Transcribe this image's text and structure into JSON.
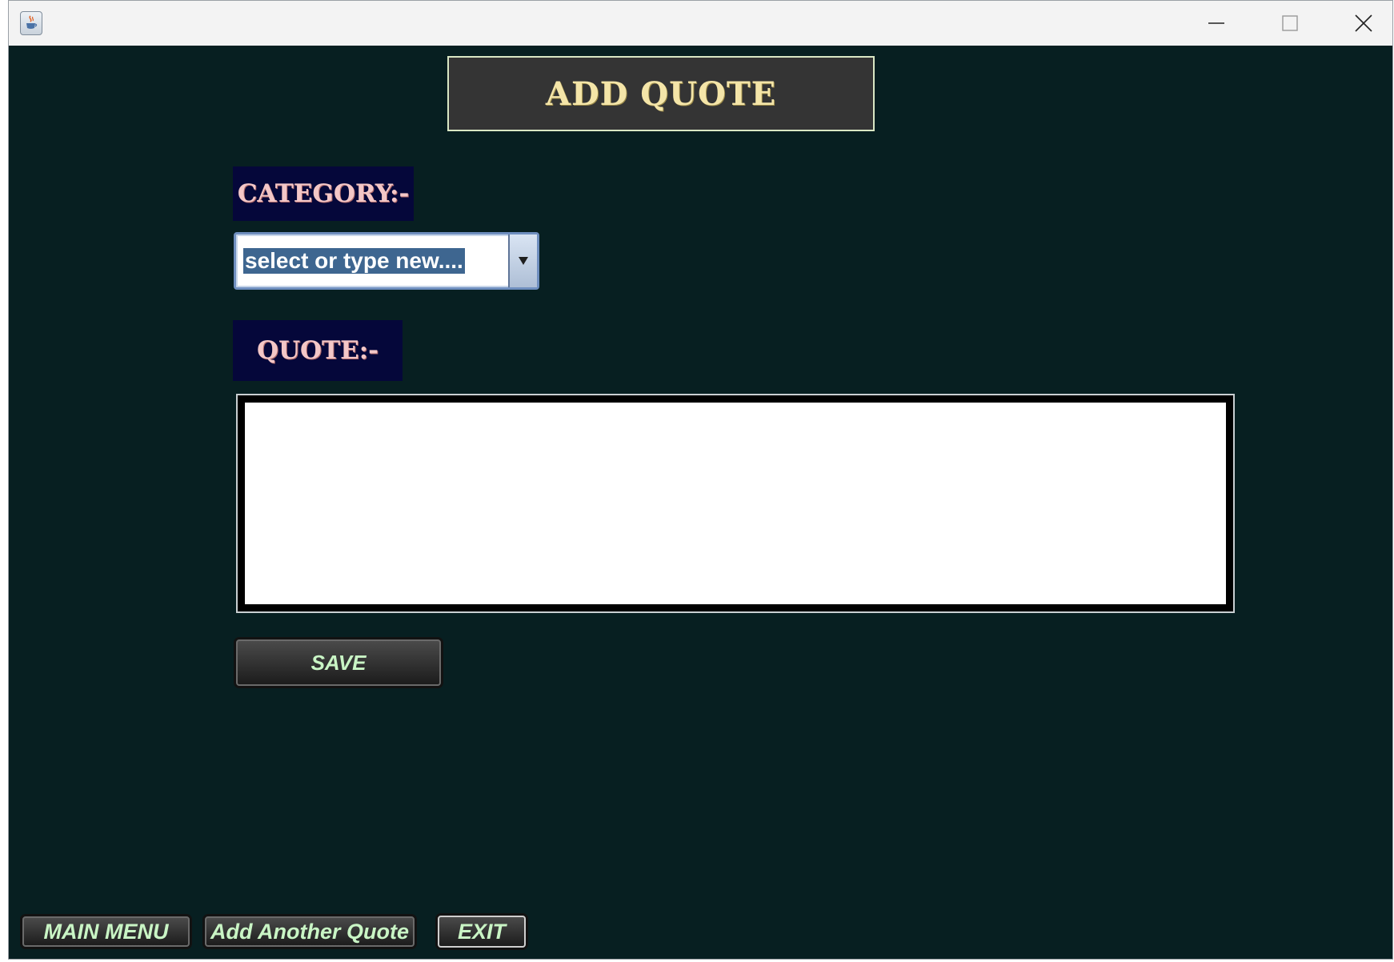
{
  "window": {
    "controls": {
      "minimize_icon": "minimize-icon",
      "maximize_icon": "maximize-icon",
      "close_icon": "close-icon"
    },
    "app_icon": "java-cup-icon"
  },
  "header": {
    "title": "ADD QUOTE"
  },
  "form": {
    "category_label": "CATEGORY:-",
    "category_combo": {
      "value": "select or type new...."
    },
    "quote_label": "QUOTE:-",
    "quote_text": "",
    "save_label": "SAVE"
  },
  "footer": {
    "main_menu_label": "MAIN MENU",
    "add_another_label": "Add Another Quote",
    "exit_label": "EXIT"
  },
  "colors": {
    "background": "#071f21",
    "label_bg": "#05073a",
    "label_text": "#f3c7c7",
    "header_text": "#f4e5a8",
    "button_text": "#c9f5c5",
    "selection": "#3e6690"
  }
}
